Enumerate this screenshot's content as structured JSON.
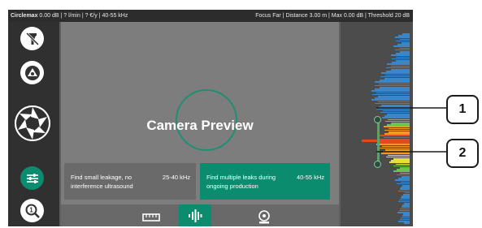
{
  "topbar": {
    "left_bold": "Circlemax",
    "left_rest": " 0.00 dB | ? l/min | ? €/y | 40-55 kHz",
    "right": "Focus Far | Distance 3.00 m | Max 0.00 dB | Threshold 20 dB"
  },
  "sidebar": {
    "buttons": [
      {
        "icon": "no-light-icon"
      },
      {
        "icon": "laser-icon"
      },
      {
        "icon": "aperture-icon"
      },
      {
        "icon": "settings-sliders-icon"
      },
      {
        "icon": "zoom-icon"
      }
    ]
  },
  "preview": {
    "title": "Camera Preview"
  },
  "options": [
    {
      "desc": "Find small leakage, no interference ultrasound",
      "freq": "25-40 kHz",
      "selected": false
    },
    {
      "desc": "Find multiple leaks during ongoing production",
      "freq": "40-55 kHz",
      "selected": true
    }
  ],
  "modes": [
    {
      "icon": "ruler-icon",
      "active": false
    },
    {
      "icon": "sound-bars-icon",
      "active": true
    },
    {
      "icon": "sensor-icon",
      "active": false
    }
  ],
  "callouts": [
    "1",
    "2"
  ],
  "colors": {
    "accent": "#0c8c6e",
    "spectrum_blue": "#3a86c8",
    "spectrum_red": "#e24a1c",
    "spectrum_orange": "#f29a22",
    "spectrum_yellow": "#e2e23a",
    "spectrum_green": "#6cc24a"
  }
}
